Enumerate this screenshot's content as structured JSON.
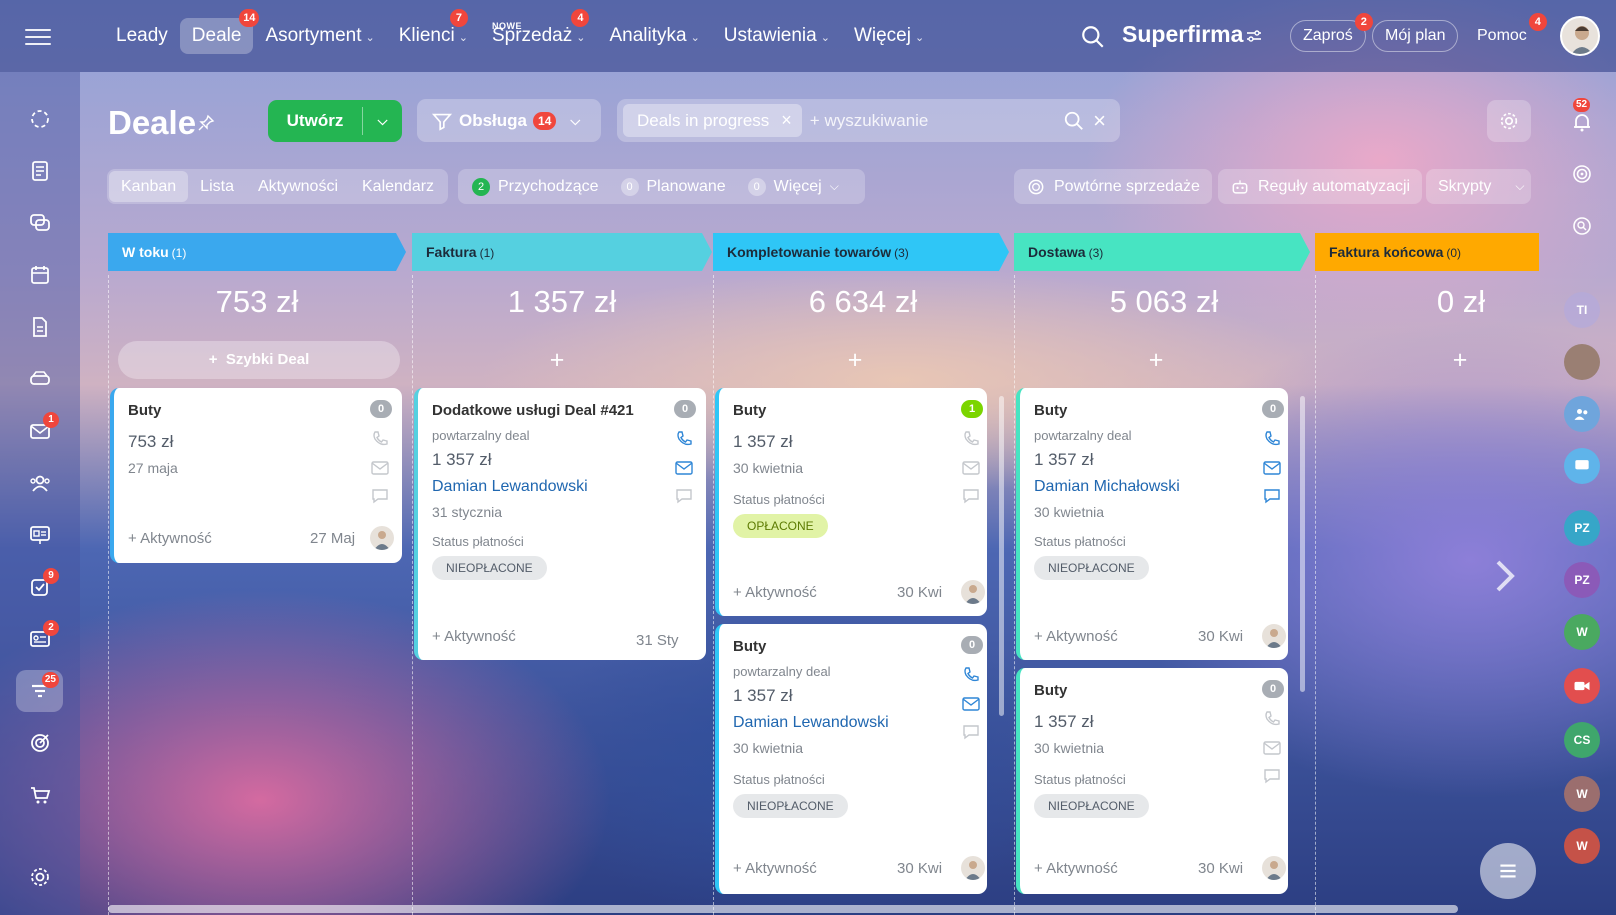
{
  "topnav": {
    "items": [
      {
        "label": "Leady",
        "badge": ""
      },
      {
        "label": "Deale",
        "badge": "14"
      },
      {
        "label": "Asortyment",
        "badge": ""
      },
      {
        "label": "Klienci",
        "badge": "7"
      },
      {
        "label": "Sprzedaż",
        "badge": "4",
        "tag": "NOWE"
      },
      {
        "label": "Analityka",
        "badge": ""
      },
      {
        "label": "Ustawienia",
        "badge": ""
      },
      {
        "label": "Więcej",
        "badge": ""
      }
    ],
    "brand": "Superfirma",
    "invite": {
      "label": "Zaproś",
      "badge": "2"
    },
    "plan": "Mój plan",
    "help": {
      "label": "Pomoc",
      "badge": "4"
    }
  },
  "leftbar": {
    "badges": {
      "mail": "1",
      "tasks": "9",
      "sites": "2",
      "crm": "25"
    }
  },
  "rightbar": {
    "bell_badge": "52",
    "avatars": [
      "TI",
      "PZ",
      "PZ",
      "W",
      "CS",
      "W",
      "W"
    ]
  },
  "toolbar": {
    "title": "Deale",
    "create_label": "Utwórz",
    "obsluga_label": "Obsługa",
    "obsluga_count": "14",
    "filter_chip": "Deals in progress",
    "search_placeholder": "+ wyszukiwanie"
  },
  "views": [
    "Kanban",
    "Lista",
    "Aktywności",
    "Kalendarz"
  ],
  "counters": [
    {
      "count": "2",
      "label": "Przychodzące"
    },
    {
      "count": "0",
      "label": "Planowane"
    },
    {
      "count": "0",
      "label": "Więcej"
    }
  ],
  "actions": {
    "repeat_sales": "Powtórne sprzedaże",
    "automation": "Reguły automatyzacji",
    "scripts": "Skrypty"
  },
  "stages": [
    {
      "name": "W toku",
      "count": "(1)",
      "sum": "753 zł",
      "color": "#3aa8ee"
    },
    {
      "name": "Faktura",
      "count": "(1)",
      "sum": "1 357 zł",
      "color": "#55d0e0"
    },
    {
      "name": "Kompletowanie towarów",
      "count": "(3)",
      "sum": "6 634 zł",
      "color": "#2fc6f6"
    },
    {
      "name": "Dostawa",
      "count": "(3)",
      "sum": "5 063 zł",
      "color": "#47e4c2"
    },
    {
      "name": "Faktura końcowa",
      "count": "(0)",
      "sum": "0 zł",
      "color": "#ffa900"
    }
  ],
  "quick_deal": "Szybki Deal",
  "cards": {
    "c1": {
      "title": "Buty",
      "amount": "753 zł",
      "date": "27 maja",
      "count": "0",
      "activity": "+ Aktywność",
      "footer_date": "27 Maj"
    },
    "c2": {
      "title": "Dodatkowe usługi Deal #421",
      "sub": "powtarzalny deal",
      "amount": "1 357 zł",
      "contact": "Damian Lewandowski",
      "date": "31 stycznia",
      "count": "0",
      "status_label": "Status płatności",
      "status": "NIEOPŁACONE",
      "activity": "+ Aktywność",
      "footer_date": "31 Sty"
    },
    "c3": {
      "title": "Buty",
      "amount": "1 357 zł",
      "date": "30 kwietnia",
      "count": "1",
      "status_label": "Status płatności",
      "status": "OPŁACONE",
      "activity": "+ Aktywność",
      "footer_date": "30 Kwi"
    },
    "c4": {
      "title": "Buty",
      "sub": "powtarzalny deal",
      "amount": "1 357 zł",
      "contact": "Damian Lewandowski",
      "date": "30 kwietnia",
      "count": "0",
      "status_label": "Status płatności",
      "status": "NIEOPŁACONE",
      "activity": "+ Aktywność",
      "footer_date": "30 Kwi"
    },
    "c5": {
      "title": "Buty",
      "sub": "powtarzalny deal",
      "amount": "1 357 zł",
      "contact": "Damian Michałowski",
      "date": "30 kwietnia",
      "count": "0",
      "status_label": "Status płatności",
      "status": "NIEOPŁACONE",
      "activity": "+ Aktywność",
      "footer_date": "30 Kwi"
    },
    "c6": {
      "title": "Buty",
      "amount": "1 357 zł",
      "date": "30 kwietnia",
      "count": "0",
      "status_label": "Status płatności",
      "status": "NIEOPŁACONE",
      "activity": "+ Aktywność",
      "footer_date": "30 Kwi"
    }
  }
}
